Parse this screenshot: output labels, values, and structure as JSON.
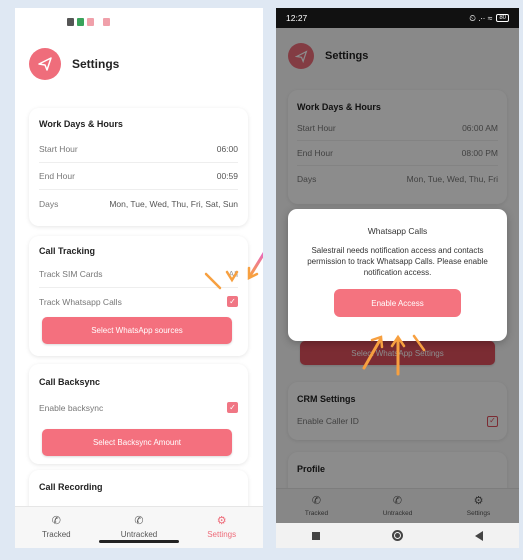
{
  "left": {
    "header_title": "Settings",
    "work": {
      "title": "Work Days & Hours",
      "rows": [
        {
          "label": "Start Hour",
          "value": "06:00"
        },
        {
          "label": "End Hour",
          "value": "00:59"
        },
        {
          "label": "Days",
          "value": "Mon, Tue, Wed, Thu, Fri, Sat, Sun"
        }
      ]
    },
    "tracking": {
      "title": "Call Tracking",
      "sim_label": "Track SIM Cards",
      "sim_value": "All",
      "whatsapp_label": "Track Whatsapp Calls",
      "button": "Select WhatsApp sources"
    },
    "backsync": {
      "title": "Call Backsync",
      "enable_label": "Enable backsync",
      "button": "Select Backsync Amount"
    },
    "recording": {
      "title": "Call Recording"
    },
    "nav": {
      "tracked": "Tracked",
      "untracked": "Untracked",
      "settings": "Settings"
    }
  },
  "right": {
    "status": {
      "time": "12:27",
      "status_icons": "⏲ .∙∙ ≈",
      "battery": "80"
    },
    "header_title": "Settings",
    "work": {
      "title": "Work Days & Hours",
      "rows": [
        {
          "label": "Start Hour",
          "value": "06:00 AM"
        },
        {
          "label": "End Hour",
          "value": "08:00 PM"
        },
        {
          "label": "Days",
          "value": "Mon, Tue, Wed, Thu, Fri"
        }
      ]
    },
    "behind_btn": "Select WhatsApp Settings",
    "crm": {
      "title": "CRM Settings",
      "enable_caller_id": "Enable Caller ID"
    },
    "profile": {
      "title": "Profile"
    },
    "nav": {
      "tracked": "Tracked",
      "untracked": "Untracked",
      "settings": "Settings"
    },
    "dialog": {
      "title": "Whatsapp Calls",
      "message": "Salestrail needs notification access and contacts permission to track Whatsapp Calls. Please enable notification access.",
      "button": "Enable Access"
    }
  },
  "colors": {
    "accent": "#f4707e",
    "overlay": "rgba(0,0,0,0.45)"
  }
}
